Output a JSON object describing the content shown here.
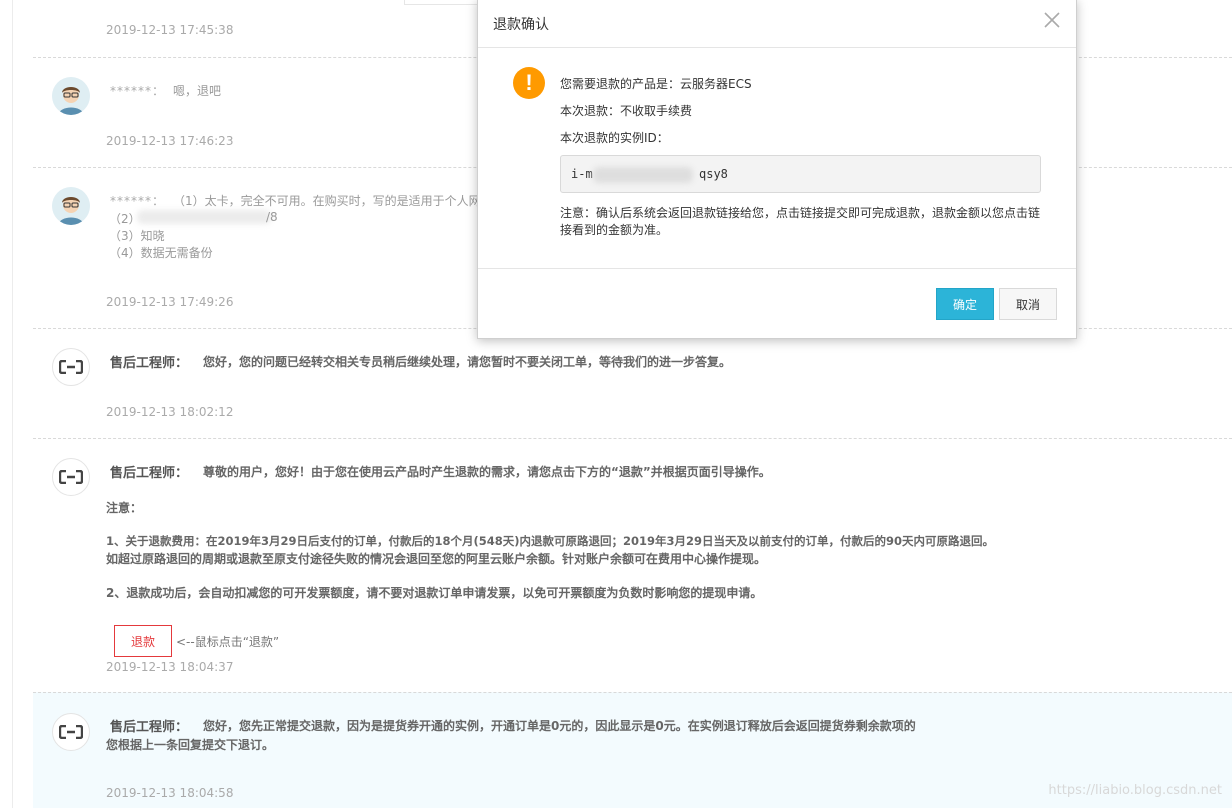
{
  "messages": [
    {
      "timestamp": "2019-12-13 17:45:38"
    },
    {
      "sender": "******：",
      "text": "嗯，退吧",
      "timestamp": "2019-12-13 17:46:23"
    },
    {
      "sender": "******：",
      "line1": "（1）太卡，完全不可用。在购买时，写的是适用于个人网",
      "line2_prefix": "（2）",
      "line2_suffix": "/8",
      "line3": "（3）知晓",
      "line4": "（4）数据无需备份",
      "timestamp": "2019-12-13 17:49:26"
    },
    {
      "sender": "售后工程师：",
      "text": "您好，您的问题已经转交相关专员稍后继续处理，请您暂时不要关闭工单，等待我们的进一步答复。",
      "timestamp": "2019-12-13 18:02:12"
    },
    {
      "sender": "售后工程师：",
      "text": "尊敬的用户，您好！由于您在使用云产品时产生退款的需求，请您点击下方的“退款”并根据页面引导操作。",
      "note_label": "注意：",
      "p1": "1、关于退款费用：在2019年3月29日后支付的订单，付款后的18个月(548天)内退款可原路退回；2019年3月29日当天及以前支付的订单，付款后的90天内可原路退回。",
      "p1b": "如超过原路退回的周期或退款至原支付途径失败的情况会退回至您的阿里云账户余额。针对账户余额可在费用中心操作提现。",
      "p2": "2、退款成功后，会自动扣减您的可开发票额度，请不要对退款订单申请发票，以免可开票额度为负数时影响您的提现申请。",
      "refund_button": "退款",
      "refund_hint": "<--鼠标点击“退款”",
      "timestamp": "2019-12-13 18:04:37"
    },
    {
      "sender": "售后工程师：",
      "text": "您好，您先正常提交退款，因为是提货券开通的实例，开通订单是0元的，因此显示是0元。在实例退订释放后会返回提货券剩余款项的",
      "text2": "您根据上一条回复提交下退订。",
      "timestamp": "2019-12-13 18:04:58"
    }
  ],
  "modal": {
    "title": "退款确认",
    "product_line": "您需要退款的产品是：云服务器ECS",
    "fee_line": "本次退款：不收取手续费",
    "instance_label": "本次退款的实例ID：",
    "instance_id_prefix": "i-m",
    "instance_id_suffix": "qsy8",
    "note": "注意：确认后系统会返回退款链接给您，点击链接提交即可完成退款，退款金额以您点击链接看到的金额为准。",
    "ok_label": "确定",
    "cancel_label": "取消"
  },
  "watermark": "https://liabio.blog.csdn.net",
  "colors": {
    "accent": "#2cb4d8",
    "warning": "#ff9a00",
    "refund": "#e4393c"
  }
}
